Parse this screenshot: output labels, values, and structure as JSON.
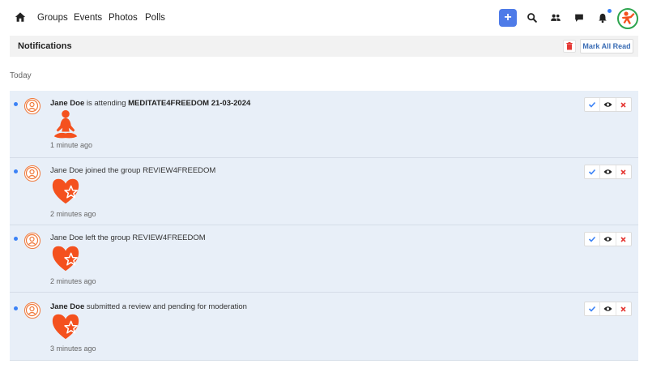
{
  "nav": {
    "links": [
      "Groups",
      "Events",
      "Photos",
      "Polls"
    ],
    "plus_label": "+",
    "accent": "#4e7be8"
  },
  "header": {
    "title": "Notifications",
    "mark_all_read": "Mark All Read"
  },
  "section_label": "Today",
  "notifications": [
    {
      "name": "Jane Doe",
      "action": " is attending ",
      "target": "MEDITATE4FREEDOM 21-03-2024",
      "time": "1 minute ago",
      "image": "meditation-icon",
      "name_bold": true
    },
    {
      "name": "Jane Doe",
      "action": " joined the group REVIEW4FREEDOM",
      "target": "",
      "time": "2 minutes ago",
      "image": "heart-star-icon",
      "name_bold": false
    },
    {
      "name": "Jane Doe",
      "action": " left the group REVIEW4FREEDOM",
      "target": "",
      "time": "2 minutes ago",
      "image": "heart-star-icon",
      "name_bold": false
    },
    {
      "name": "Jane Doe",
      "action": " submitted a review and pending for moderation",
      "target": "",
      "time": "3 minutes ago",
      "image": "heart-star-icon",
      "name_bold": true
    }
  ],
  "colors": {
    "row_bg": "#e8eff8",
    "unread_dot": "#3b82f6",
    "orange": "#f4511e",
    "check": "#3b82f6",
    "close": "#e53935"
  }
}
